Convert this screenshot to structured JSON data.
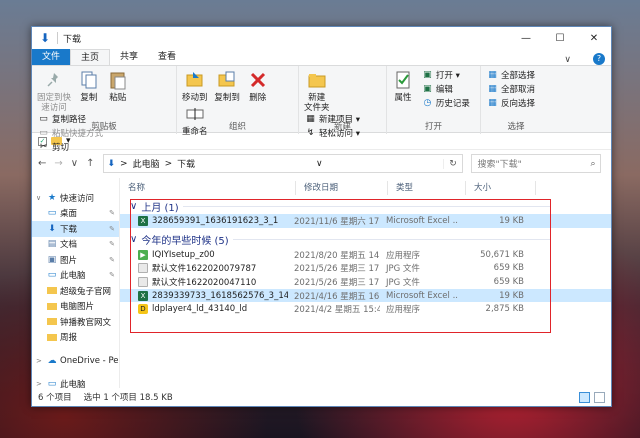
{
  "window": {
    "title": "下载",
    "controls": {
      "minimize": "—",
      "maximize": "☐",
      "close": "✕"
    }
  },
  "ribbon": {
    "tabs": [
      {
        "label": "文件"
      },
      {
        "label": "主页"
      },
      {
        "label": "共享"
      },
      {
        "label": "查看"
      }
    ],
    "collapse_glyph": "∨",
    "help_glyph": "?",
    "groups": {
      "clipboard": {
        "label": "剪贴板",
        "pin_quick_access": "固定到快\n速访问",
        "copy": "复制",
        "paste": "粘贴",
        "copy_path": "复制路径",
        "paste_shortcut": "粘贴快捷方式",
        "cut": "剪切"
      },
      "organize": {
        "label": "组织",
        "move_to": "移动到",
        "copy_to": "复制到",
        "delete": "删除",
        "rename": "重命名"
      },
      "new": {
        "label": "新建",
        "new_folder": "新建\n文件夹",
        "new_item": "新建项目 ▾",
        "easy_access": "轻松访问 ▾"
      },
      "open": {
        "label": "打开",
        "properties": "属性",
        "open": "打开 ▾",
        "edit": "编辑",
        "history": "历史记录"
      },
      "select": {
        "label": "选择",
        "select_all": "全部选择",
        "select_none": "全部取消",
        "invert": "反向选择"
      }
    }
  },
  "quick_access_strip": {
    "dropdown": "▾"
  },
  "addressbar": {
    "path": [
      "此电脑",
      "下载"
    ],
    "separator": ">",
    "dropdown": "∨",
    "refresh": "↻",
    "search_placeholder": "搜索\"下载\"",
    "search_glyph": "⌕"
  },
  "navpane": {
    "items": [
      {
        "label": "快速访问",
        "icon": "star-icon",
        "glyph": "★",
        "pinned": false,
        "expander": "∨"
      },
      {
        "label": "桌面",
        "icon": "desktop-icon",
        "glyph": "▭",
        "pinned": true
      },
      {
        "label": "下载",
        "icon": "download-icon",
        "glyph": "⬇",
        "pinned": true
      },
      {
        "label": "文档",
        "icon": "document-icon",
        "glyph": "▤",
        "pinned": true
      },
      {
        "label": "图片",
        "icon": "picture-icon",
        "glyph": "▣",
        "pinned": true
      },
      {
        "label": "此电脑",
        "icon": "computer-icon",
        "glyph": "▭",
        "pinned": true
      },
      {
        "label": "超级兔子官网",
        "icon": "folder-icon",
        "glyph": "",
        "pinned": false
      },
      {
        "label": "电脑图片",
        "icon": "folder-icon",
        "glyph": "",
        "pinned": false
      },
      {
        "label": "钟播教官网文",
        "icon": "folder-icon",
        "glyph": "",
        "pinned": false
      },
      {
        "label": "周报",
        "icon": "folder-icon",
        "glyph": "",
        "pinned": false
      },
      {
        "label": "OneDrive - Pe",
        "icon": "cloud-icon",
        "glyph": "☁",
        "pinned": false,
        "expander": ">"
      },
      {
        "label": "此电脑",
        "icon": "computer-icon",
        "glyph": "▭",
        "pinned": false,
        "expander": ">"
      }
    ],
    "pin_glyph": "📌"
  },
  "columns": {
    "name": "名称",
    "date": "修改日期",
    "type": "类型",
    "size": "大小"
  },
  "groups": [
    {
      "header": "上月 (1)",
      "files": [
        {
          "name": "328659391_1636191623_3_1",
          "date": "2021/11/6 星期六 17:...",
          "type": "Microsoft Excel ...",
          "size": "19 KB",
          "icon": "excel-icon",
          "selected": true
        }
      ]
    },
    {
      "header": "今年的早些时候 (5)",
      "files": [
        {
          "name": "IQIYIsetup_z00",
          "date": "2021/8/20 星期五 14:...",
          "type": "应用程序",
          "size": "50,671 KB",
          "icon": "app-icon",
          "selected": false
        },
        {
          "name": "默认文件1622020079787",
          "date": "2021/5/26 星期三 17:...",
          "type": "JPG 文件",
          "size": "659 KB",
          "icon": "jpg-icon",
          "selected": false
        },
        {
          "name": "默认文件1622020047110",
          "date": "2021/5/26 星期三 17:...",
          "type": "JPG 文件",
          "size": "659 KB",
          "icon": "jpg-icon",
          "selected": false
        },
        {
          "name": "2839339733_1618562576_3_14",
          "date": "2021/4/16 星期五 16:...",
          "type": "Microsoft Excel ...",
          "size": "19 KB",
          "icon": "excel-icon",
          "selected": true
        },
        {
          "name": "ldplayer4_ld_43140_ld",
          "date": "2021/4/2 星期五 15:47",
          "type": "应用程序",
          "size": "2,875 KB",
          "icon": "ldplayer-icon",
          "selected": false
        }
      ]
    }
  ],
  "statusbar": {
    "count": "6 个项目",
    "selected": "选中 1 个项目  18.5 KB"
  },
  "colors": {
    "accent": "#1979ca",
    "selection": "#cce8ff",
    "annotation_box": "#e0242a",
    "group_header": "#1e3287"
  }
}
